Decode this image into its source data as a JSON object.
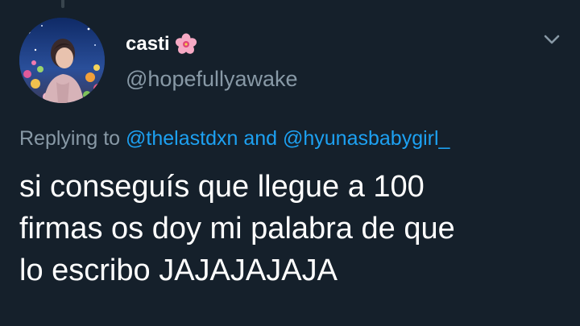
{
  "author": {
    "display_name": "casti",
    "handle": "@hopefullyawake",
    "name_emoji": "hibiscus-flower-icon"
  },
  "reply": {
    "prefix": "Replying to",
    "mention_1": "@thelastdxn",
    "conjunction": "and",
    "mention_2": "@hyunasbabygirl_"
  },
  "tweet": {
    "lines": [
      "si conseguís que llegue a 100",
      "firmas os doy mi palabra de que",
      "lo escribo JAJAJAJAJA"
    ]
  },
  "colors": {
    "background": "#15202b",
    "text": "#ffffff",
    "secondary_text": "#8899a6",
    "link": "#1da1f2"
  }
}
